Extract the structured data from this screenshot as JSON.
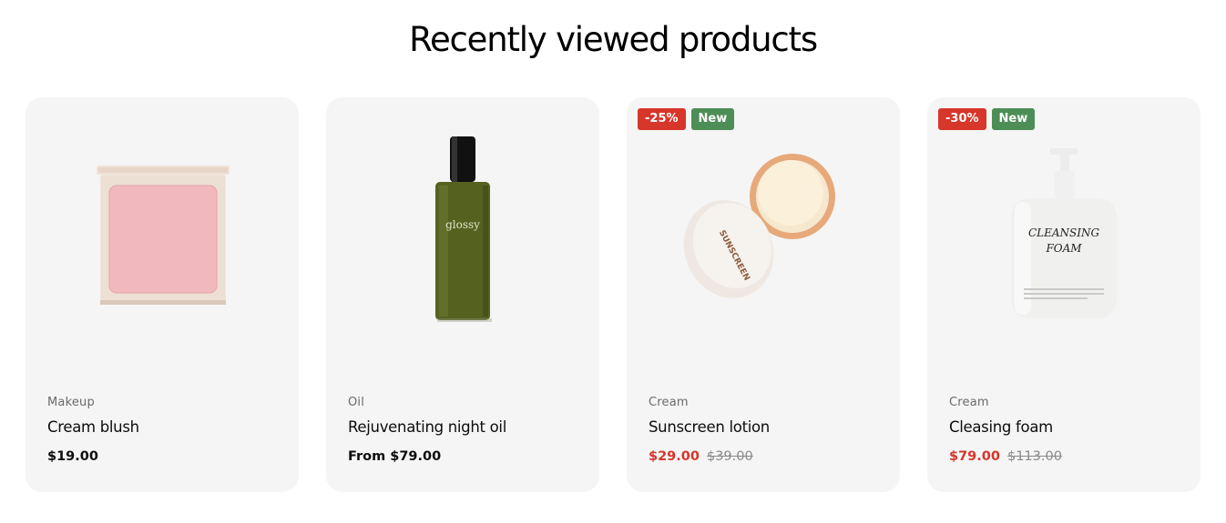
{
  "section": {
    "title": "Recently viewed products"
  },
  "products": [
    {
      "category": "Makeup",
      "name": "Cream blush",
      "price": "$19.00",
      "compare_price": "",
      "badges": [],
      "image_icon": "blush-compact-image"
    },
    {
      "category": "Oil",
      "name": "Rejuvenating night oil",
      "price": "From $79.00",
      "compare_price": "",
      "badges": [],
      "image_icon": "oil-bottle-image",
      "bottle_label": "glossy"
    },
    {
      "category": "Cream",
      "name": "Sunscreen lotion",
      "price": "$29.00",
      "compare_price": "$39.00",
      "badges": [
        "-25%",
        "New"
      ],
      "image_icon": "sunscreen-jar-image",
      "jar_label": "SUNSCREEN"
    },
    {
      "category": "Cream",
      "name": "Cleasing foam",
      "price": "$79.00",
      "compare_price": "$113.00",
      "badges": [
        "-30%",
        "New"
      ],
      "image_icon": "pump-bottle-image",
      "bottle_label_line1": "CLEANSING",
      "bottle_label_line2": "FOAM"
    }
  ],
  "colors": {
    "sale": "#d7362b",
    "new": "#4d8e57",
    "card_bg": "#f5f5f5"
  }
}
